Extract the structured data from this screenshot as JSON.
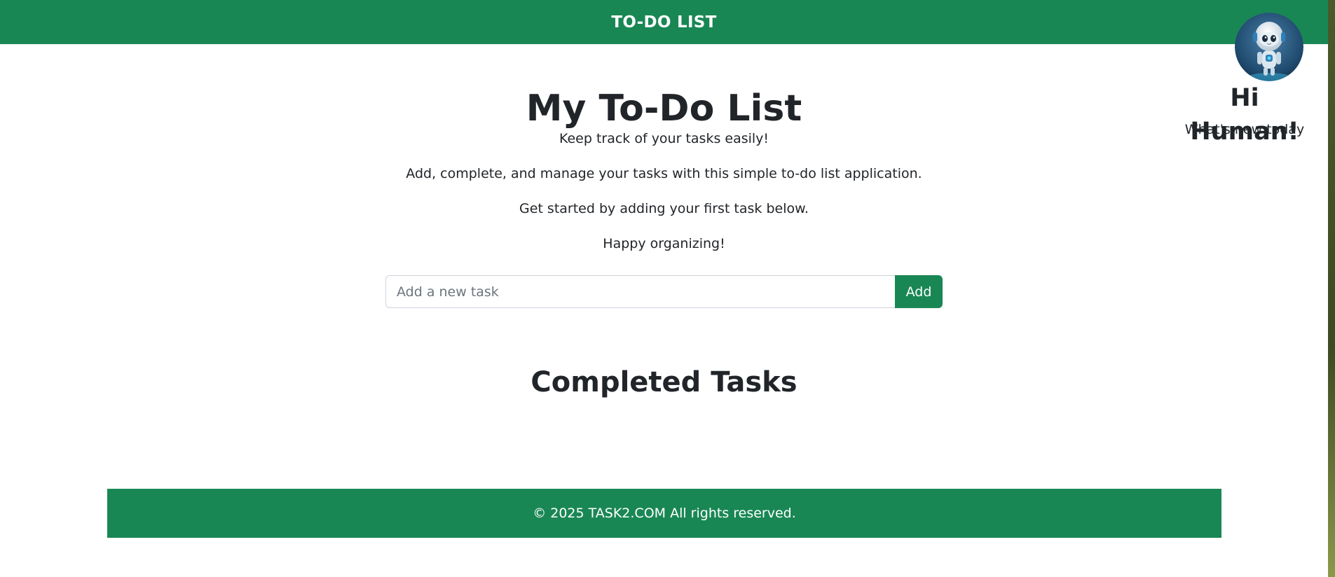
{
  "colors": {
    "brand": "#198754",
    "text": "#212529",
    "placeholder": "#6c757d"
  },
  "navbar": {
    "title": "TO-DO LIST"
  },
  "main": {
    "heading": "My To-Do List",
    "tagline": "Keep track of your tasks easily!",
    "description": "Add, complete, and manage your tasks with this simple to-do list application.",
    "prompt": "Get started by adding your first task below.",
    "signoff": "Happy organizing!"
  },
  "task_form": {
    "placeholder": "Add a new task",
    "value": "",
    "add_label": "Add"
  },
  "completed": {
    "heading": "Completed Tasks",
    "items": []
  },
  "profile": {
    "avatar_icon": "robot-avatar-icon",
    "greeting": "Hi Human!",
    "subtitle": "What's new today"
  },
  "footer": {
    "text": "© 2025 TASK2.COM All rights reserved."
  }
}
